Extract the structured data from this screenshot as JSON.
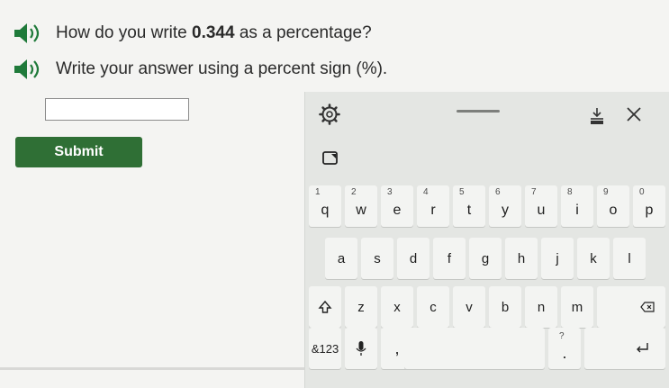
{
  "question": {
    "line1_pre": "How do you write ",
    "line1_num": "0.344",
    "line1_post": " as a percentage?",
    "line2": "Write your answer using a percent sign (%)."
  },
  "answer": {
    "value": ""
  },
  "submit_label": "Submit",
  "keyboard": {
    "row1": [
      {
        "num": "1",
        "ltr": "q"
      },
      {
        "num": "2",
        "ltr": "w"
      },
      {
        "num": "3",
        "ltr": "e"
      },
      {
        "num": "4",
        "ltr": "r"
      },
      {
        "num": "5",
        "ltr": "t"
      },
      {
        "num": "6",
        "ltr": "y"
      },
      {
        "num": "7",
        "ltr": "u"
      },
      {
        "num": "8",
        "ltr": "i"
      },
      {
        "num": "9",
        "ltr": "o"
      },
      {
        "num": "0",
        "ltr": "p"
      }
    ],
    "row2": [
      "a",
      "s",
      "d",
      "f",
      "g",
      "h",
      "j",
      "k",
      "l"
    ],
    "row3": [
      "z",
      "x",
      "c",
      "v",
      "b",
      "n",
      "m"
    ],
    "symbols_label": "&123",
    "comma": ",",
    "period_hint": "?",
    "period": "."
  },
  "colors": {
    "submit_bg": "#2f6f35",
    "keyboard_bg": "#e4e6e3"
  },
  "icons": [
    "speaker-icon",
    "gear-icon",
    "dock-icon",
    "close-icon",
    "paintbrush-icon",
    "shift-icon",
    "backspace-icon",
    "microphone-icon",
    "enter-icon"
  ]
}
